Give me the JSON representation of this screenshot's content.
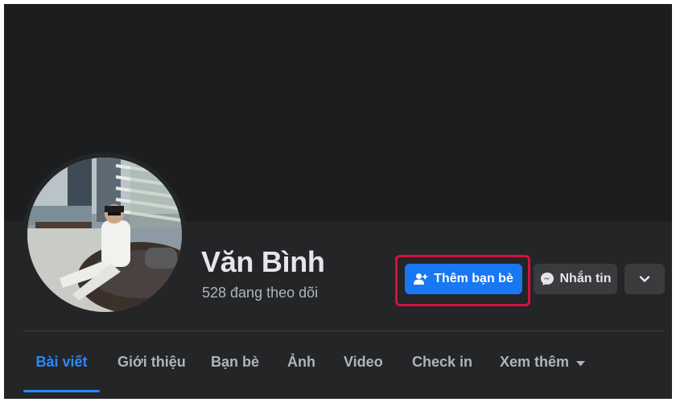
{
  "profile": {
    "name": "Văn Bình",
    "followers": "528 đang theo dõi"
  },
  "actions": {
    "add_friend": "Thêm bạn bè",
    "message": "Nhắn tin"
  },
  "tabs": [
    {
      "label": "Bài viết",
      "active": true
    },
    {
      "label": "Giới thiệu",
      "active": false
    },
    {
      "label": "Bạn bè",
      "active": false
    },
    {
      "label": "Ảnh",
      "active": false
    },
    {
      "label": "Video",
      "active": false
    },
    {
      "label": "Check in",
      "active": false
    },
    {
      "label": "Xem thêm",
      "active": false
    }
  ],
  "colors": {
    "background": "#242526",
    "cover": "#1c1d1f",
    "accent": "#1877f2",
    "active_tab": "#2d88ff",
    "highlight_border": "#d1123f",
    "secondary_button": "#3a3b3c"
  },
  "icons": {
    "add_friend": "person-add-icon",
    "message": "messenger-icon",
    "more": "chevron-down-icon",
    "see_more": "caret-down-icon"
  }
}
